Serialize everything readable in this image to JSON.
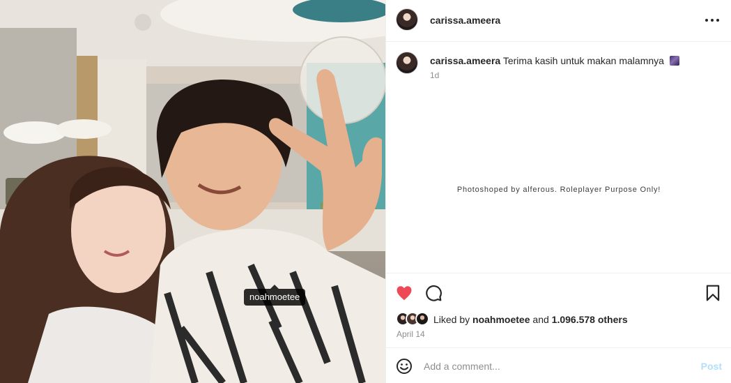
{
  "post": {
    "author": "carissa.ameera",
    "tag": "noahmoetee",
    "caption_user": "carissa.ameera",
    "caption_text": "Terima kasih untuk makan malamnya",
    "time_ago": "1d",
    "watermark": "Photoshoped by alferous. Roleplayer Purpose Only!",
    "liked_prefix": "Liked by",
    "liked_user": "noahmoetee",
    "liked_and": "and",
    "liked_count": "1.096.578 others",
    "date": "April 14"
  },
  "comment": {
    "placeholder": "Add a comment...",
    "post_label": "Post"
  },
  "icons": {
    "more": "more-horizontal-icon",
    "heart": "heart-filled-icon",
    "comment": "comment-bubble-icon",
    "save": "bookmark-icon",
    "emoji": "smiley-icon"
  },
  "colors": {
    "heart": "#ed4956",
    "post_disabled": "#b2dffc",
    "text": "#262626",
    "muted": "#8e8e8e"
  }
}
